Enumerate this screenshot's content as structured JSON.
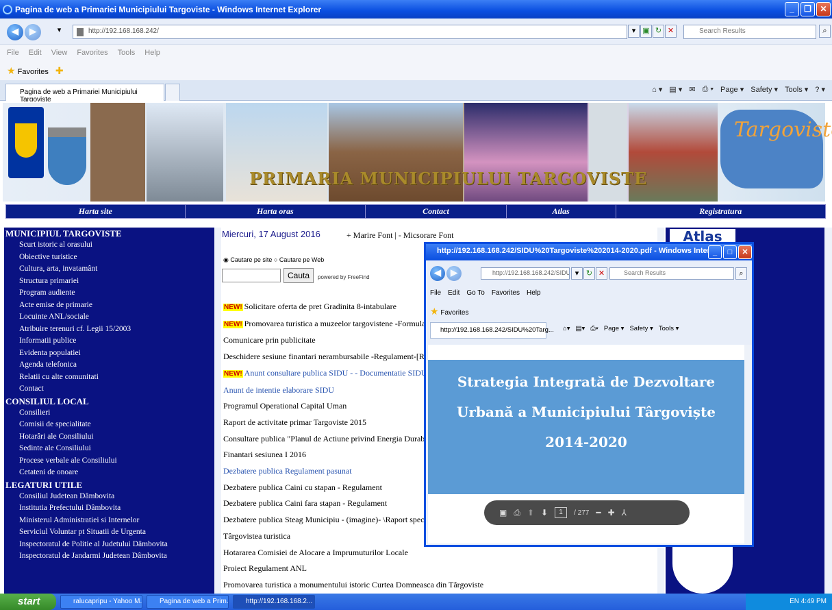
{
  "window": {
    "title": "Pagina de web a Primariei Municipiului Targoviste - Windows Internet Explorer"
  },
  "address": {
    "url": "http://192.168.168.242/",
    "search_placeholder": "Search Results"
  },
  "menu": [
    "File",
    "Edit",
    "View",
    "Favorites",
    "Tools",
    "Help"
  ],
  "favorites_label": "Favorites",
  "tab": {
    "label": "Pagina de web a Primariei Municipiului Targoviste"
  },
  "commands": [
    "Page ▾",
    "Safety ▾",
    "Tools ▾"
  ],
  "banner": {
    "title": "PRIMARIA MUNICIPIULUI TARGOVISTE",
    "map_title": "Targoviste"
  },
  "topnav": [
    "Harta site",
    "Harta oras",
    "Contact",
    "Atlas",
    "Registratura"
  ],
  "sidebar": {
    "sections": [
      {
        "heading": "MUNICIPIUL TARGOVISTE",
        "items": [
          "Scurt istoric al orasului",
          "Obiective turistice",
          "Cultura, arta, invatamânt",
          "Structura primariei",
          "Program audiente",
          "Acte emise de primarie",
          "Locuinte ANL/sociale",
          "Atribuire terenuri cf. Legii 15/2003",
          "Informatii publice",
          "Evidenta populatiei",
          "Agenda telefonica",
          "Relatii cu alte comunitati",
          "Contact"
        ]
      },
      {
        "heading": "CONSILIUL LOCAL",
        "items": [
          "Consilieri",
          "Comisii de specialitate",
          "Hotarâri ale Consiliului",
          "Sedinte ale Consiliului",
          "Procese verbale ale Consiliului",
          "Cetateni de onoare"
        ]
      },
      {
        "heading": "LEGATURI UTILE",
        "items": [
          "Consiliul Judetean Dâmbovita",
          "Institutia Prefectului Dâmbovita",
          "Ministerul Administratiei si Internelor",
          "Serviciul Voluntar pt Situatii de Urgenta",
          "Inspectoratul de Politie al Judetului Dâmbovita",
          "Inspectoratul de Jandarmi Judetean Dâmbovita"
        ]
      }
    ]
  },
  "main": {
    "date": "Miercuri, 17 August 2016",
    "font_increase": "+ Marire Font",
    "font_sep": " | ",
    "font_decrease": "- Micsorare Font",
    "radio_site": "Cautare pe site",
    "radio_web": "Cautare pe Web",
    "search_button": "Cauta",
    "powered": "powered by FreeFind",
    "new_badge": "NEW!",
    "news": [
      {
        "text": "Solicitare oferta de pret Gradinita 8-intabulare",
        "new": true,
        "blue": false
      },
      {
        "text": "Promovarea turistica a muzeelor targovistene -Formulare -",
        "new": true,
        "blue": false
      },
      {
        "text": "Comunicare prin publicitate",
        "new": false,
        "blue": false
      },
      {
        "text": "Deschidere sesiune finantari nerambursabile -Regulament-[Regul",
        "new": false,
        "blue": false
      },
      {
        "text": "Anunt consultare publica SIDU - - Documentatie SIDU",
        "new": true,
        "blue": true
      },
      {
        "text": "Anunt de intentie elaborare SIDU",
        "new": false,
        "blue": true
      },
      {
        "text": "Programul Operational Capital Uman",
        "new": false,
        "blue": false
      },
      {
        "text": "Raport de activitate primar Targoviste 2015",
        "new": false,
        "blue": false
      },
      {
        "text": "Consultare publica \"Planul de Actiune privind Energia Durabila\"",
        "new": false,
        "blue": false
      },
      {
        "text": "Finantari sesiunea I 2016",
        "new": false,
        "blue": false
      },
      {
        "text": "Dezbatere publica Regulament pasunat",
        "new": false,
        "blue": true
      },
      {
        "text": "Dezbatere publica Caini cu stapan - Regulament",
        "new": false,
        "blue": false
      },
      {
        "text": "Dezbatere publica Caini fara stapan - Regulament",
        "new": false,
        "blue": false
      },
      {
        "text": "Dezbatere publica Steag Municipiu - (imagine)- \\Raport speciali",
        "new": false,
        "blue": false
      },
      {
        "text": "Târgovistea turistica",
        "new": false,
        "blue": false
      },
      {
        "text": "Hotararea Comisiei de Alocare a Imprumuturilor Locale",
        "new": false,
        "blue": false
      },
      {
        "text": "Proiect Regulament ANL",
        "new": false,
        "blue": false
      },
      {
        "text": "Promovarea turistica a monumentului istoric Curtea Domneasca din Târgoviste",
        "new": false,
        "blue": false
      }
    ]
  },
  "right": {
    "atlas_logo": "Atlas"
  },
  "popup": {
    "title": "http://192.168.168.242/SIDU%20Targoviste%202014-2020.pdf - Windows Internet ...",
    "url": "http://192.168.168.242/SIDU",
    "search_placeholder": "Search Results",
    "menu": [
      "File",
      "Edit",
      "Go To",
      "Favorites",
      "Help"
    ],
    "favorites_label": "Favorites",
    "tab_label": "http://192.168.168.242/SIDU%20Targ...",
    "commands": [
      "Page ▾",
      "Safety ▾",
      "Tools ▾"
    ],
    "pdf_lines": [
      "Strategia Integrată de Dezvoltare",
      "Urbană a Municipiului Târgoviște",
      "2014-2020"
    ],
    "page_current": "1",
    "page_total": "/ 277"
  },
  "taskbar": {
    "start": "start",
    "tasks": [
      "ralucapripu - Yahoo M...",
      "Pagina de web a Prim...",
      "http://192.168.168.2..."
    ],
    "tray": "EN    4:49 PM"
  }
}
